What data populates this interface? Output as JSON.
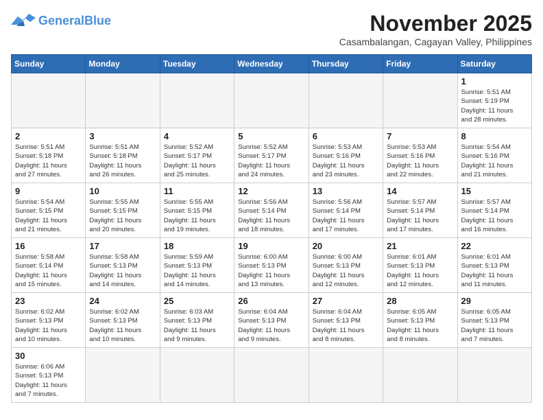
{
  "header": {
    "logo_general": "General",
    "logo_blue": "Blue",
    "month_year": "November 2025",
    "location": "Casambalangan, Cagayan Valley, Philippines"
  },
  "weekdays": [
    "Sunday",
    "Monday",
    "Tuesday",
    "Wednesday",
    "Thursday",
    "Friday",
    "Saturday"
  ],
  "weeks": [
    [
      {
        "day": "",
        "info": ""
      },
      {
        "day": "",
        "info": ""
      },
      {
        "day": "",
        "info": ""
      },
      {
        "day": "",
        "info": ""
      },
      {
        "day": "",
        "info": ""
      },
      {
        "day": "",
        "info": ""
      },
      {
        "day": "1",
        "info": "Sunrise: 5:51 AM\nSunset: 5:19 PM\nDaylight: 11 hours\nand 28 minutes."
      }
    ],
    [
      {
        "day": "2",
        "info": "Sunrise: 5:51 AM\nSunset: 5:18 PM\nDaylight: 11 hours\nand 27 minutes."
      },
      {
        "day": "3",
        "info": "Sunrise: 5:51 AM\nSunset: 5:18 PM\nDaylight: 11 hours\nand 26 minutes."
      },
      {
        "day": "4",
        "info": "Sunrise: 5:52 AM\nSunset: 5:17 PM\nDaylight: 11 hours\nand 25 minutes."
      },
      {
        "day": "5",
        "info": "Sunrise: 5:52 AM\nSunset: 5:17 PM\nDaylight: 11 hours\nand 24 minutes."
      },
      {
        "day": "6",
        "info": "Sunrise: 5:53 AM\nSunset: 5:16 PM\nDaylight: 11 hours\nand 23 minutes."
      },
      {
        "day": "7",
        "info": "Sunrise: 5:53 AM\nSunset: 5:16 PM\nDaylight: 11 hours\nand 22 minutes."
      },
      {
        "day": "8",
        "info": "Sunrise: 5:54 AM\nSunset: 5:16 PM\nDaylight: 11 hours\nand 21 minutes."
      }
    ],
    [
      {
        "day": "9",
        "info": "Sunrise: 5:54 AM\nSunset: 5:15 PM\nDaylight: 11 hours\nand 21 minutes."
      },
      {
        "day": "10",
        "info": "Sunrise: 5:55 AM\nSunset: 5:15 PM\nDaylight: 11 hours\nand 20 minutes."
      },
      {
        "day": "11",
        "info": "Sunrise: 5:55 AM\nSunset: 5:15 PM\nDaylight: 11 hours\nand 19 minutes."
      },
      {
        "day": "12",
        "info": "Sunrise: 5:56 AM\nSunset: 5:14 PM\nDaylight: 11 hours\nand 18 minutes."
      },
      {
        "day": "13",
        "info": "Sunrise: 5:56 AM\nSunset: 5:14 PM\nDaylight: 11 hours\nand 17 minutes."
      },
      {
        "day": "14",
        "info": "Sunrise: 5:57 AM\nSunset: 5:14 PM\nDaylight: 11 hours\nand 17 minutes."
      },
      {
        "day": "15",
        "info": "Sunrise: 5:57 AM\nSunset: 5:14 PM\nDaylight: 11 hours\nand 16 minutes."
      }
    ],
    [
      {
        "day": "16",
        "info": "Sunrise: 5:58 AM\nSunset: 5:14 PM\nDaylight: 11 hours\nand 15 minutes."
      },
      {
        "day": "17",
        "info": "Sunrise: 5:58 AM\nSunset: 5:13 PM\nDaylight: 11 hours\nand 14 minutes."
      },
      {
        "day": "18",
        "info": "Sunrise: 5:59 AM\nSunset: 5:13 PM\nDaylight: 11 hours\nand 14 minutes."
      },
      {
        "day": "19",
        "info": "Sunrise: 6:00 AM\nSunset: 5:13 PM\nDaylight: 11 hours\nand 13 minutes."
      },
      {
        "day": "20",
        "info": "Sunrise: 6:00 AM\nSunset: 5:13 PM\nDaylight: 11 hours\nand 12 minutes."
      },
      {
        "day": "21",
        "info": "Sunrise: 6:01 AM\nSunset: 5:13 PM\nDaylight: 11 hours\nand 12 minutes."
      },
      {
        "day": "22",
        "info": "Sunrise: 6:01 AM\nSunset: 5:13 PM\nDaylight: 11 hours\nand 11 minutes."
      }
    ],
    [
      {
        "day": "23",
        "info": "Sunrise: 6:02 AM\nSunset: 5:13 PM\nDaylight: 11 hours\nand 10 minutes."
      },
      {
        "day": "24",
        "info": "Sunrise: 6:02 AM\nSunset: 5:13 PM\nDaylight: 11 hours\nand 10 minutes."
      },
      {
        "day": "25",
        "info": "Sunrise: 6:03 AM\nSunset: 5:13 PM\nDaylight: 11 hours\nand 9 minutes."
      },
      {
        "day": "26",
        "info": "Sunrise: 6:04 AM\nSunset: 5:13 PM\nDaylight: 11 hours\nand 9 minutes."
      },
      {
        "day": "27",
        "info": "Sunrise: 6:04 AM\nSunset: 5:13 PM\nDaylight: 11 hours\nand 8 minutes."
      },
      {
        "day": "28",
        "info": "Sunrise: 6:05 AM\nSunset: 5:13 PM\nDaylight: 11 hours\nand 8 minutes."
      },
      {
        "day": "29",
        "info": "Sunrise: 6:05 AM\nSunset: 5:13 PM\nDaylight: 11 hours\nand 7 minutes."
      }
    ],
    [
      {
        "day": "30",
        "info": "Sunrise: 6:06 AM\nSunset: 5:13 PM\nDaylight: 11 hours\nand 7 minutes."
      },
      {
        "day": "",
        "info": ""
      },
      {
        "day": "",
        "info": ""
      },
      {
        "day": "",
        "info": ""
      },
      {
        "day": "",
        "info": ""
      },
      {
        "day": "",
        "info": ""
      },
      {
        "day": "",
        "info": ""
      }
    ]
  ]
}
